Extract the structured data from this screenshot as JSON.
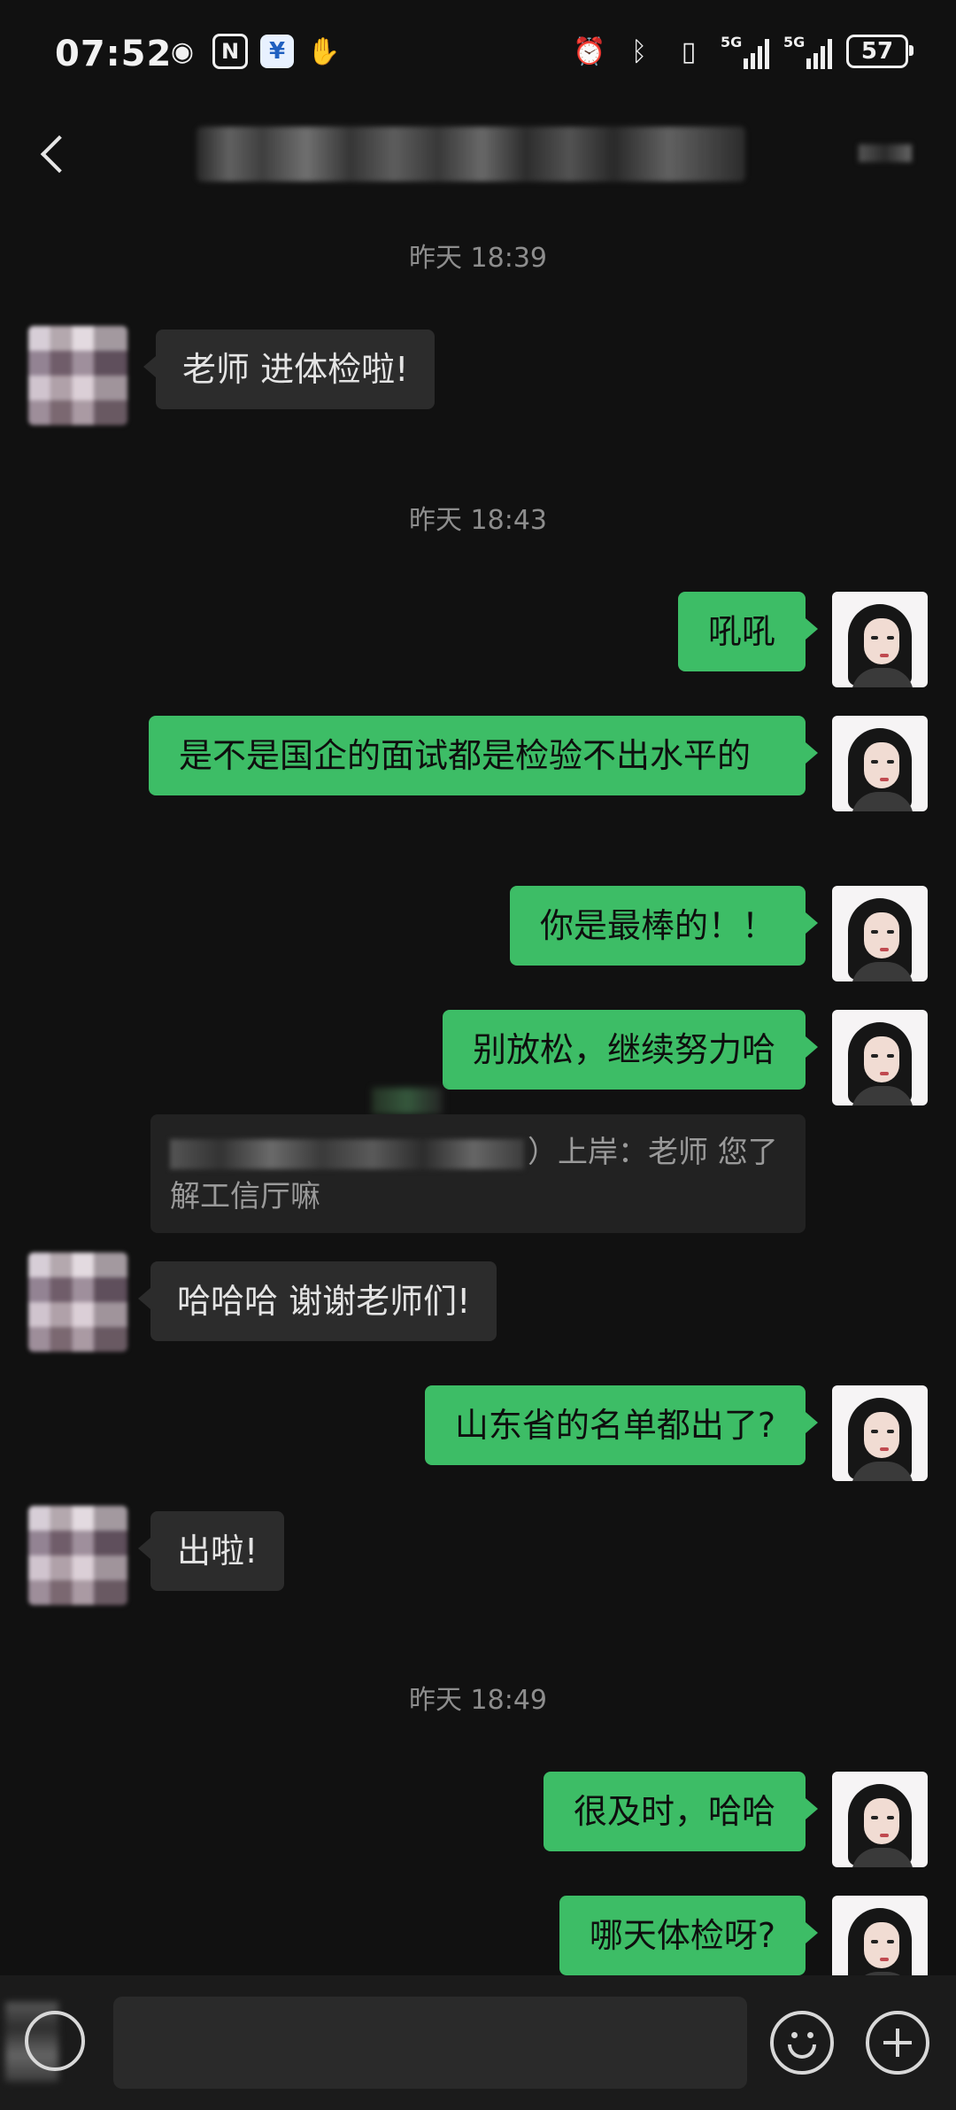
{
  "status_bar": {
    "time": "07:52",
    "left_icons": [
      "eye-icon",
      "nfc-icon",
      "app-icon",
      "hand-icon"
    ],
    "right_icons": [
      "alarm-icon",
      "bluetooth-icon",
      "vibrate-icon",
      "signal-5g-1",
      "signal-5g-2"
    ],
    "network_label_1": "5G",
    "network_label_2": "5G",
    "battery": "57"
  },
  "messages": {
    "t1": "昨天 18:39",
    "m1": "老师 进体检啦!",
    "t2": "昨天 18:43",
    "m2": "吼吼",
    "m3": "是不是国企的面试都是检验不出水平的",
    "m4": "你是最棒的！！",
    "m5": "别放松，继续努力哈",
    "quote_text": "）上岸：老师 您了解工信厅嘛",
    "m6": "哈哈哈 谢谢老师们!",
    "m7": "山东省的名单都出了?",
    "m8": "出啦!",
    "t3": "昨天 18:49",
    "m9": "很及时，哈哈",
    "m10": "哪天体检呀?"
  }
}
